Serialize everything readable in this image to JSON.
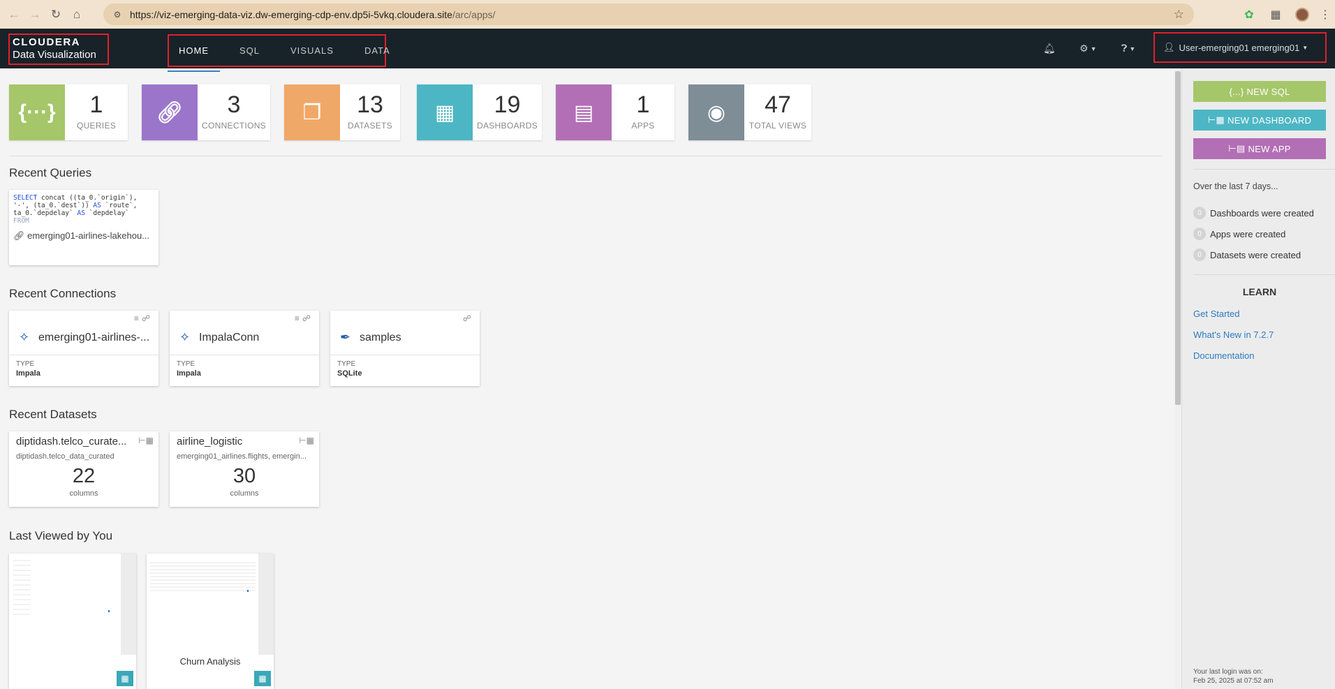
{
  "browser": {
    "url_main": "https://viz-emerging-data-viz.dw-emerging-cdp-env.dp5i-5vkq.cloudera.site",
    "url_path": "/arc/apps/"
  },
  "header": {
    "logo_title": "CLOUDERA",
    "logo_subtitle": "Data Visualization",
    "nav": [
      "HOME",
      "SQL",
      "VISUALS",
      "DATA"
    ],
    "user": "User-emerging01 emerging01"
  },
  "stats": [
    {
      "value": "1",
      "label": "QUERIES",
      "color": "#a6c66a",
      "icon": "braces-icon"
    },
    {
      "value": "3",
      "label": "CONNECTIONS",
      "color": "#9b75c9",
      "icon": "link-icon"
    },
    {
      "value": "13",
      "label": "DATASETS",
      "color": "#f0a868",
      "icon": "cubes-icon"
    },
    {
      "value": "19",
      "label": "DASHBOARDS",
      "color": "#4db6c4",
      "icon": "dashboard-icon"
    },
    {
      "value": "1",
      "label": "APPS",
      "color": "#b26fb5",
      "icon": "app-icon"
    },
    {
      "value": "47",
      "label": "TOTAL VIEWS",
      "color": "#7e8d96",
      "icon": "eye-icon"
    }
  ],
  "sections": {
    "recent_queries": "Recent Queries",
    "recent_connections": "Recent Connections",
    "recent_datasets": "Recent Datasets",
    "last_viewed": "Last Viewed by You"
  },
  "query": {
    "line1": "SELECT concat ((ta_0.`origin`),",
    "line2": "'-', (ta_0.`dest`)) AS `route`,",
    "line3": "ta_0.`depdelay` AS `depdelay`",
    "line4": "FROM",
    "connection": "emerging01-airlines-lakehou..."
  },
  "connections": [
    {
      "name": "emerging01-airlines-...",
      "type_label": "TYPE",
      "type": "Impala"
    },
    {
      "name": "ImpalaConn",
      "type_label": "TYPE",
      "type": "Impala"
    },
    {
      "name": "samples",
      "type_label": "TYPE",
      "type": "SQLite"
    }
  ],
  "datasets": [
    {
      "title": "diptidash.telco_curate...",
      "sub": "diptidash.telco_data_curated",
      "count": "22",
      "unit": "columns"
    },
    {
      "title": "airline_logistic",
      "sub": "emerging01_airlines.flights, emergin...",
      "count": "30",
      "unit": "columns"
    }
  ],
  "last_viewed": [
    {
      "title": ""
    },
    {
      "title": "Churn Analysis"
    }
  ],
  "sidebar": {
    "new_sql": "NEW SQL",
    "new_sql_prefix": "{...}",
    "new_dashboard": "NEW DASHBOARD",
    "new_app": "NEW APP",
    "period": "Over the last 7 days...",
    "stats": [
      {
        "count": "0",
        "label": "Dashboards were created"
      },
      {
        "count": "0",
        "label": "Apps were created"
      },
      {
        "count": "0",
        "label": "Datasets were created"
      }
    ],
    "learn": "LEARN",
    "links": [
      "Get Started",
      "What's New in 7.2.7",
      "Documentation"
    ],
    "last_login_label": "Your last login was on:",
    "last_login_value": "Feb 25, 2025 at 07:52 am",
    "colors": {
      "sql": "#a6c66a",
      "dashboard": "#4db6c4",
      "app": "#b26fb5"
    }
  }
}
